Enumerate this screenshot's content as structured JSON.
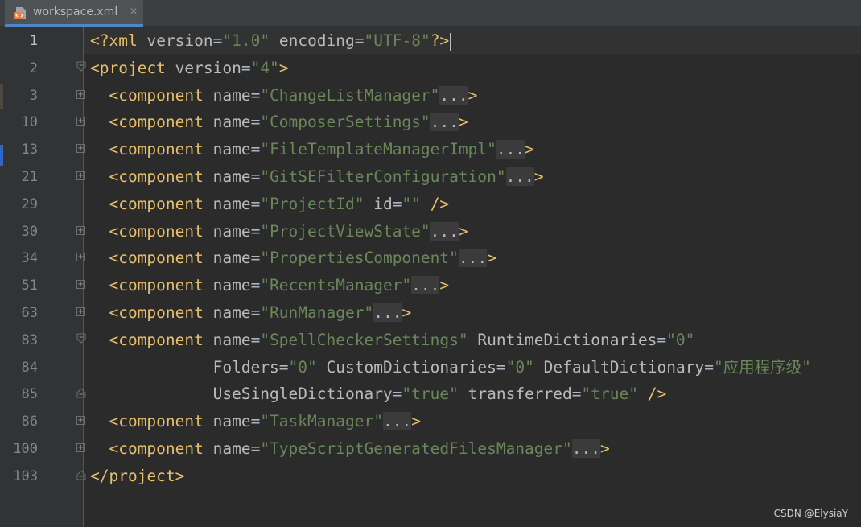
{
  "tab": {
    "title": "workspace.xml",
    "close_glyph": "✕",
    "icon": "xml-file-icon"
  },
  "colors": {
    "tag": "#e8bf6a",
    "attribute": "#bababa",
    "value": "#6a8759",
    "text": "#a9b7c6",
    "background": "#2b2b2b",
    "gutter": "#313335"
  },
  "lines": [
    {
      "num": "1",
      "fold": "",
      "active": true,
      "indent": 0,
      "tokens": [
        {
          "t": "tg",
          "v": "<?xml "
        },
        {
          "t": "at",
          "v": "version"
        },
        {
          "t": "tx",
          "v": "="
        },
        {
          "t": "vl",
          "v": "\"1.0\""
        },
        {
          "t": "tx",
          "v": " "
        },
        {
          "t": "at",
          "v": "encoding"
        },
        {
          "t": "tx",
          "v": "="
        },
        {
          "t": "vl",
          "v": "\"UTF-8\""
        },
        {
          "t": "tg",
          "v": "?>"
        }
      ]
    },
    {
      "num": "2",
      "fold": "open",
      "indent": 0,
      "tokens": [
        {
          "t": "tg",
          "v": "<project "
        },
        {
          "t": "at",
          "v": "version"
        },
        {
          "t": "tx",
          "v": "="
        },
        {
          "t": "vl",
          "v": "\"4\""
        },
        {
          "t": "tg",
          "v": ">"
        }
      ]
    },
    {
      "num": "3",
      "fold": "plus",
      "indent": 2,
      "tokens": [
        {
          "t": "tg",
          "v": "<component "
        },
        {
          "t": "at",
          "v": "name"
        },
        {
          "t": "tx",
          "v": "="
        },
        {
          "t": "vl",
          "v": "\"ChangeListManager\""
        },
        {
          "t": "fd",
          "v": "..."
        },
        {
          "t": "tg",
          "v": ">"
        }
      ]
    },
    {
      "num": "10",
      "fold": "plus",
      "indent": 2,
      "tokens": [
        {
          "t": "tg",
          "v": "<component "
        },
        {
          "t": "at",
          "v": "name"
        },
        {
          "t": "tx",
          "v": "="
        },
        {
          "t": "vl",
          "v": "\"ComposerSettings\""
        },
        {
          "t": "fd",
          "v": "..."
        },
        {
          "t": "tg",
          "v": ">"
        }
      ]
    },
    {
      "num": "13",
      "fold": "plus",
      "indent": 2,
      "tokens": [
        {
          "t": "tg",
          "v": "<component "
        },
        {
          "t": "at",
          "v": "name"
        },
        {
          "t": "tx",
          "v": "="
        },
        {
          "t": "vl",
          "v": "\"FileTemplateManagerImpl\""
        },
        {
          "t": "fd",
          "v": "..."
        },
        {
          "t": "tg",
          "v": ">"
        }
      ]
    },
    {
      "num": "21",
      "fold": "plus",
      "indent": 2,
      "tokens": [
        {
          "t": "tg",
          "v": "<component "
        },
        {
          "t": "at",
          "v": "name"
        },
        {
          "t": "tx",
          "v": "="
        },
        {
          "t": "vl",
          "v": "\"GitSEFilterConfiguration\""
        },
        {
          "t": "fd",
          "v": "..."
        },
        {
          "t": "tg",
          "v": ">"
        }
      ]
    },
    {
      "num": "29",
      "fold": "",
      "indent": 2,
      "tokens": [
        {
          "t": "tg",
          "v": "<component "
        },
        {
          "t": "at",
          "v": "name"
        },
        {
          "t": "tx",
          "v": "="
        },
        {
          "t": "vl",
          "v": "\"ProjectId\""
        },
        {
          "t": "tx",
          "v": " "
        },
        {
          "t": "at",
          "v": "id"
        },
        {
          "t": "tx",
          "v": "="
        },
        {
          "t": "vl",
          "v": "\"\""
        },
        {
          "t": "tx",
          "v": " "
        },
        {
          "t": "tg",
          "v": "/>"
        }
      ]
    },
    {
      "num": "30",
      "fold": "plus",
      "indent": 2,
      "tokens": [
        {
          "t": "tg",
          "v": "<component "
        },
        {
          "t": "at",
          "v": "name"
        },
        {
          "t": "tx",
          "v": "="
        },
        {
          "t": "vl",
          "v": "\"ProjectViewState\""
        },
        {
          "t": "fd",
          "v": "..."
        },
        {
          "t": "tg",
          "v": ">"
        }
      ]
    },
    {
      "num": "34",
      "fold": "plus",
      "indent": 2,
      "tokens": [
        {
          "t": "tg",
          "v": "<component "
        },
        {
          "t": "at",
          "v": "name"
        },
        {
          "t": "tx",
          "v": "="
        },
        {
          "t": "vl",
          "v": "\"PropertiesComponent\""
        },
        {
          "t": "fd",
          "v": "..."
        },
        {
          "t": "tg",
          "v": ">"
        }
      ]
    },
    {
      "num": "51",
      "fold": "plus",
      "indent": 2,
      "tokens": [
        {
          "t": "tg",
          "v": "<component "
        },
        {
          "t": "at",
          "v": "name"
        },
        {
          "t": "tx",
          "v": "="
        },
        {
          "t": "vl",
          "v": "\"RecentsManager\""
        },
        {
          "t": "fd",
          "v": "..."
        },
        {
          "t": "tg",
          "v": ">"
        }
      ]
    },
    {
      "num": "63",
      "fold": "plus",
      "indent": 2,
      "tokens": [
        {
          "t": "tg",
          "v": "<component "
        },
        {
          "t": "at",
          "v": "name"
        },
        {
          "t": "tx",
          "v": "="
        },
        {
          "t": "vl",
          "v": "\"RunManager\""
        },
        {
          "t": "fd",
          "v": "..."
        },
        {
          "t": "tg",
          "v": ">"
        }
      ]
    },
    {
      "num": "83",
      "fold": "open",
      "indent": 2,
      "tokens": [
        {
          "t": "tg",
          "v": "<component "
        },
        {
          "t": "at",
          "v": "name"
        },
        {
          "t": "tx",
          "v": "="
        },
        {
          "t": "vl",
          "v": "\"SpellCheckerSettings\""
        },
        {
          "t": "tx",
          "v": " "
        },
        {
          "t": "at",
          "v": "RuntimeDictionaries"
        },
        {
          "t": "tx",
          "v": "="
        },
        {
          "t": "vl",
          "v": "\"0\""
        }
      ]
    },
    {
      "num": "84",
      "fold": "",
      "indent": 13,
      "tokens": [
        {
          "t": "at",
          "v": "Folders"
        },
        {
          "t": "tx",
          "v": "="
        },
        {
          "t": "vl",
          "v": "\"0\""
        },
        {
          "t": "tx",
          "v": " "
        },
        {
          "t": "at",
          "v": "CustomDictionaries"
        },
        {
          "t": "tx",
          "v": "="
        },
        {
          "t": "vl",
          "v": "\"0\""
        },
        {
          "t": "tx",
          "v": " "
        },
        {
          "t": "at",
          "v": "DefaultDictionary"
        },
        {
          "t": "tx",
          "v": "="
        },
        {
          "t": "vl",
          "v": "\"应用程序级\""
        }
      ]
    },
    {
      "num": "85",
      "fold": "end",
      "indent": 13,
      "tokens": [
        {
          "t": "at",
          "v": "UseSingleDictionary"
        },
        {
          "t": "tx",
          "v": "="
        },
        {
          "t": "vl",
          "v": "\"true\""
        },
        {
          "t": "tx",
          "v": " "
        },
        {
          "t": "at",
          "v": "transferred"
        },
        {
          "t": "tx",
          "v": "="
        },
        {
          "t": "vl",
          "v": "\"true\""
        },
        {
          "t": "tx",
          "v": " "
        },
        {
          "t": "tg",
          "v": "/>"
        }
      ]
    },
    {
      "num": "86",
      "fold": "plus",
      "indent": 2,
      "tokens": [
        {
          "t": "tg",
          "v": "<component "
        },
        {
          "t": "at",
          "v": "name"
        },
        {
          "t": "tx",
          "v": "="
        },
        {
          "t": "vl",
          "v": "\"TaskManager\""
        },
        {
          "t": "fd",
          "v": "..."
        },
        {
          "t": "tg",
          "v": ">"
        }
      ]
    },
    {
      "num": "100",
      "fold": "plus",
      "indent": 2,
      "tokens": [
        {
          "t": "tg",
          "v": "<component "
        },
        {
          "t": "at",
          "v": "name"
        },
        {
          "t": "tx",
          "v": "="
        },
        {
          "t": "vl",
          "v": "\"TypeScriptGeneratedFilesManager\""
        },
        {
          "t": "fd",
          "v": "..."
        },
        {
          "t": "tg",
          "v": ">"
        }
      ]
    },
    {
      "num": "103",
      "fold": "end",
      "indent": 0,
      "tokens": [
        {
          "t": "tg",
          "v": "</project>"
        }
      ]
    }
  ],
  "watermark": "CSDN @ElysiaY"
}
